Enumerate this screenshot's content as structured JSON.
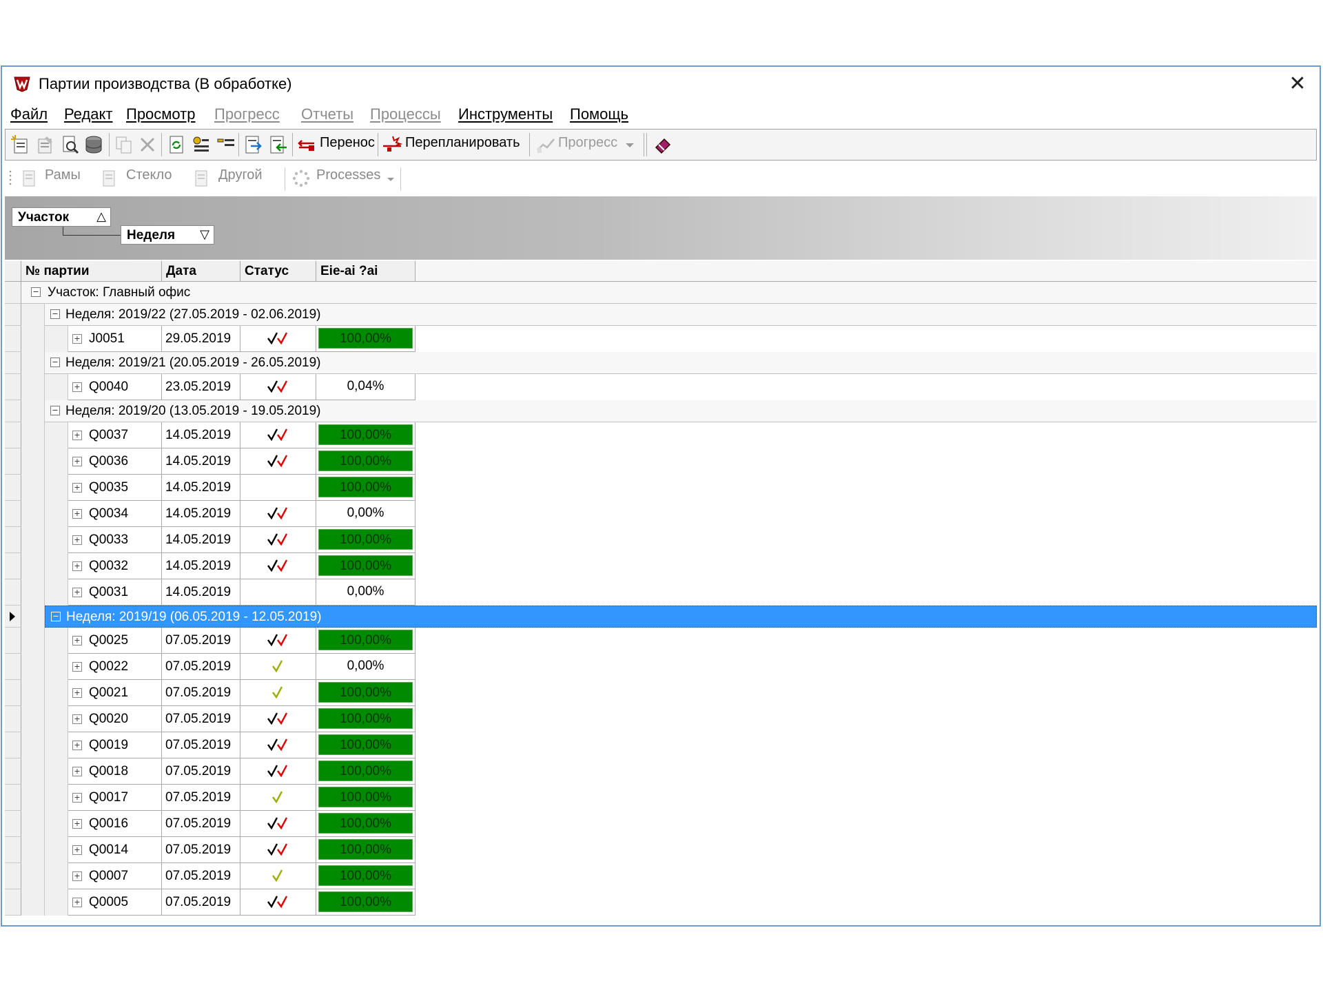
{
  "window": {
    "title": "Партии производства (В обработке)",
    "close_symbol": "✕"
  },
  "menu": [
    {
      "label": "Файл",
      "disabled": false
    },
    {
      "label": "Редакт",
      "disabled": false
    },
    {
      "label": "Просмотр",
      "disabled": false
    },
    {
      "label": "Прогресс",
      "disabled": true
    },
    {
      "label": "Отчеты",
      "disabled": true
    },
    {
      "label": "Процессы",
      "disabled": true
    },
    {
      "label": "Инструменты",
      "disabled": false
    },
    {
      "label": "Помощь",
      "disabled": false
    }
  ],
  "toolbar": {
    "transfer_label": "Перенос",
    "reschedule_label": "Перепланировать",
    "progress_label": "Прогресс"
  },
  "toolbar2": {
    "frames_label": "Рамы",
    "glass_label": "Стекло",
    "other_label": "Другой",
    "processes_label": "Processes"
  },
  "groupbox": {
    "chip1": "Участок",
    "chip1_arrow": "△",
    "chip2": "Неделя",
    "chip2_arrow": "▽"
  },
  "columns": {
    "batch": "№ партии",
    "date": "Дата",
    "status": "Статус",
    "extra": "Eie-ai ?ai"
  },
  "section": "Участок: Главный офис",
  "weeks": [
    {
      "label": "Неделя: 2019/22 (27.05.2019 - 02.06.2019)",
      "selected": false,
      "rows": [
        {
          "id": "J0051",
          "date": "29.05.2019",
          "status": "double",
          "progress": "100,00%",
          "full": true
        }
      ]
    },
    {
      "label": "Неделя: 2019/21 (20.05.2019 - 26.05.2019)",
      "selected": false,
      "rows": [
        {
          "id": "Q0040",
          "date": "23.05.2019",
          "status": "double",
          "progress": "0,04%",
          "full": false
        }
      ]
    },
    {
      "label": "Неделя: 2019/20 (13.05.2019 - 19.05.2019)",
      "selected": false,
      "rows": [
        {
          "id": "Q0037",
          "date": "14.05.2019",
          "status": "double",
          "progress": "100,00%",
          "full": true
        },
        {
          "id": "Q0036",
          "date": "14.05.2019",
          "status": "double",
          "progress": "100,00%",
          "full": true
        },
        {
          "id": "Q0035",
          "date": "14.05.2019",
          "status": "none",
          "progress": "100,00%",
          "full": true
        },
        {
          "id": "Q0034",
          "date": "14.05.2019",
          "status": "double",
          "progress": "0,00%",
          "full": false
        },
        {
          "id": "Q0033",
          "date": "14.05.2019",
          "status": "double",
          "progress": "100,00%",
          "full": true
        },
        {
          "id": "Q0032",
          "date": "14.05.2019",
          "status": "double",
          "progress": "100,00%",
          "full": true
        },
        {
          "id": "Q0031",
          "date": "14.05.2019",
          "status": "none",
          "progress": "0,00%",
          "full": false
        }
      ]
    },
    {
      "label": "Неделя: 2019/19 (06.05.2019 - 12.05.2019)",
      "selected": true,
      "rows": [
        {
          "id": "Q0025",
          "date": "07.05.2019",
          "status": "double",
          "progress": "100,00%",
          "full": true
        },
        {
          "id": "Q0022",
          "date": "07.05.2019",
          "status": "single",
          "progress": "0,00%",
          "full": false
        },
        {
          "id": "Q0021",
          "date": "07.05.2019",
          "status": "single",
          "progress": "100,00%",
          "full": true
        },
        {
          "id": "Q0020",
          "date": "07.05.2019",
          "status": "double",
          "progress": "100,00%",
          "full": true
        },
        {
          "id": "Q0019",
          "date": "07.05.2019",
          "status": "double",
          "progress": "100,00%",
          "full": true
        },
        {
          "id": "Q0018",
          "date": "07.05.2019",
          "status": "double",
          "progress": "100,00%",
          "full": true
        },
        {
          "id": "Q0017",
          "date": "07.05.2019",
          "status": "single",
          "progress": "100,00%",
          "full": true
        },
        {
          "id": "Q0016",
          "date": "07.05.2019",
          "status": "double",
          "progress": "100,00%",
          "full": true
        },
        {
          "id": "Q0014",
          "date": "07.05.2019",
          "status": "double",
          "progress": "100,00%",
          "full": true
        },
        {
          "id": "Q0007",
          "date": "07.05.2019",
          "status": "single",
          "progress": "100,00%",
          "full": true
        },
        {
          "id": "Q0005",
          "date": "07.05.2019",
          "status": "double",
          "progress": "100,00%",
          "full": true
        }
      ]
    }
  ],
  "colors": {
    "progress_full": "#008a00",
    "selection": "#3296ff",
    "check_black": "#000000",
    "check_red": "#e00000",
    "check_olive": "#9ab000"
  }
}
